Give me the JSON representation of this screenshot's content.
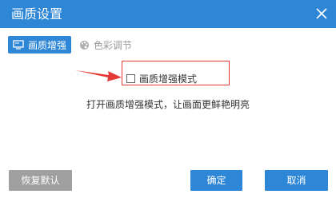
{
  "window": {
    "title": "画质设置",
    "close_icon": "close-icon"
  },
  "tabs": [
    {
      "label": "画质增强",
      "icon": "display-icon",
      "active": true
    },
    {
      "label": "色彩调节",
      "icon": "palette-icon",
      "active": false
    }
  ],
  "option": {
    "checkbox_label": "画质增强模式",
    "checked": false,
    "description": "打开画质增强模式，让画面更鲜艳明亮"
  },
  "buttons": {
    "reset": "恢复默认",
    "ok": "确定",
    "cancel": "取消"
  },
  "colors": {
    "accent": "#2e86d6",
    "highlight": "#e53935",
    "disabled_button": "#a0a0a0"
  }
}
